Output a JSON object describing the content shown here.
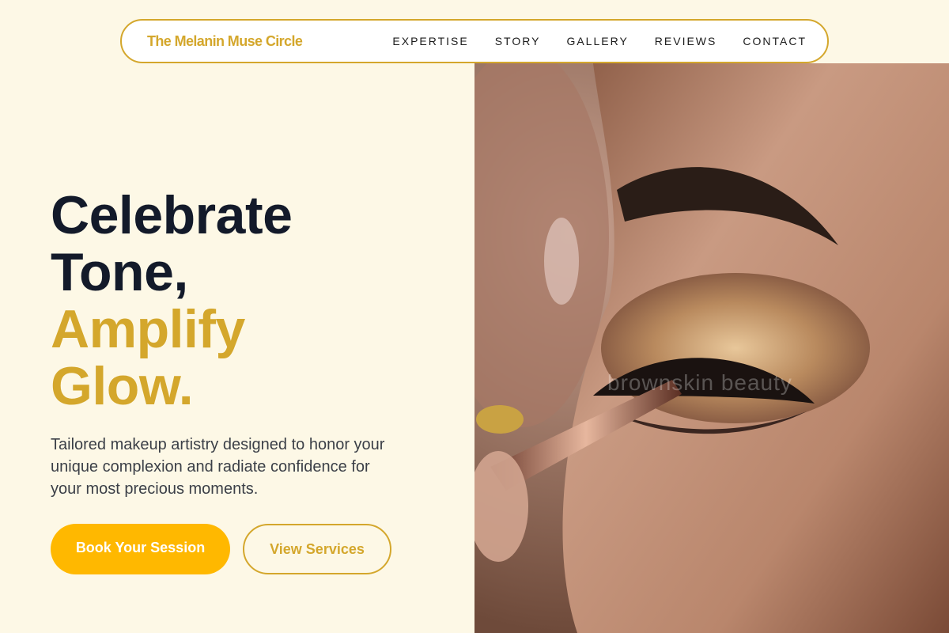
{
  "nav": {
    "brand": "The Melanin Muse Circle",
    "links": [
      "EXPERTISE",
      "STORY",
      "GALLERY",
      "REVIEWS",
      "CONTACT"
    ]
  },
  "hero": {
    "headline_line1": "Celebrate",
    "headline_line2": "Tone,",
    "headline_line3": "Amplify",
    "headline_line4": "Glow.",
    "subtext": "Tailored makeup artistry designed to honor your unique complexion and radiate confidence for your most precious moments.",
    "primary_button": "Book Your Session",
    "secondary_button": "View Services",
    "image_watermark": "brownskin beauty"
  },
  "colors": {
    "background": "#fdf8e6",
    "gold": "#d4a72c",
    "button_yellow": "#ffb800",
    "heading_dark": "#131a2a"
  }
}
